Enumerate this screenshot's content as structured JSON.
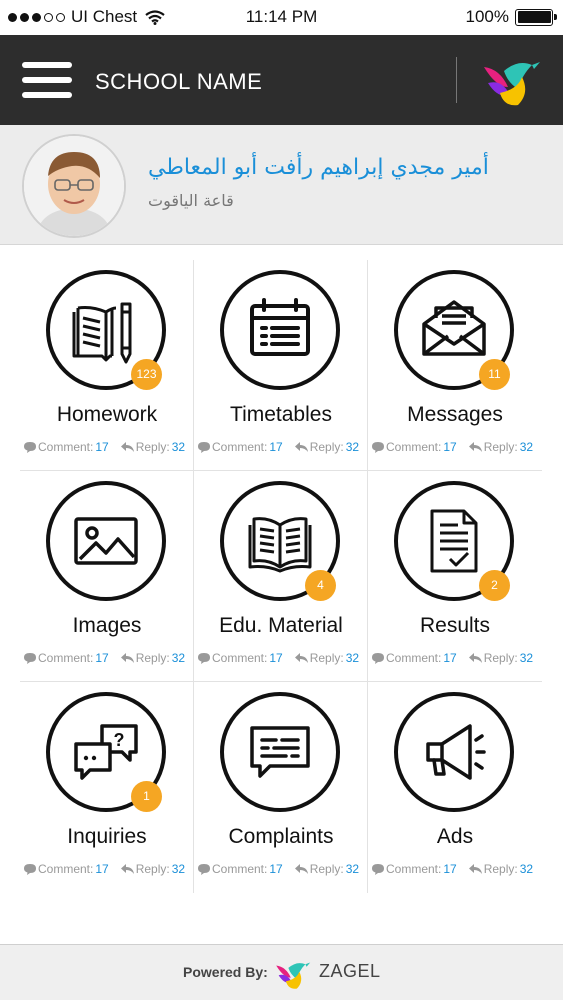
{
  "status_bar": {
    "carrier": "UI Chest",
    "time": "11:14 PM",
    "battery": "100%"
  },
  "header": {
    "school_name": "SCHOOL NAME"
  },
  "profile": {
    "student_name": "أمير مجدي إبراهيم رأفت أبو المعاطي",
    "hall": "قاعة الياقوت"
  },
  "meta_labels": {
    "comment": "Comment:",
    "reply": "Reply:"
  },
  "tiles": [
    {
      "label": "Homework",
      "badge": "123",
      "comments": "17",
      "replies": "32",
      "icon": "book-pencil-icon"
    },
    {
      "label": "Timetables",
      "badge": "",
      "comments": "17",
      "replies": "32",
      "icon": "calendar-icon"
    },
    {
      "label": "Messages",
      "badge": "11",
      "comments": "17",
      "replies": "32",
      "icon": "envelope-icon"
    },
    {
      "label": "Images",
      "badge": "",
      "comments": "17",
      "replies": "32",
      "icon": "image-icon"
    },
    {
      "label": "Edu. Material",
      "badge": "4",
      "comments": "17",
      "replies": "32",
      "icon": "open-book-icon"
    },
    {
      "label": "Results",
      "badge": "2",
      "comments": "17",
      "replies": "32",
      "icon": "document-check-icon"
    },
    {
      "label": "Inquiries",
      "badge": "1",
      "comments": "17",
      "replies": "32",
      "icon": "chat-question-icon"
    },
    {
      "label": "Complaints",
      "badge": "",
      "comments": "17",
      "replies": "32",
      "icon": "chat-lines-icon"
    },
    {
      "label": "Ads",
      "badge": "",
      "comments": "17",
      "replies": "32",
      "icon": "megaphone-icon"
    }
  ],
  "footer": {
    "powered_by": "Powered By:",
    "brand": "ZAGEL"
  },
  "colors": {
    "header_bg": "#2d2d2d",
    "accent_blue": "#1a8fd8",
    "badge_orange": "#f5a623"
  }
}
